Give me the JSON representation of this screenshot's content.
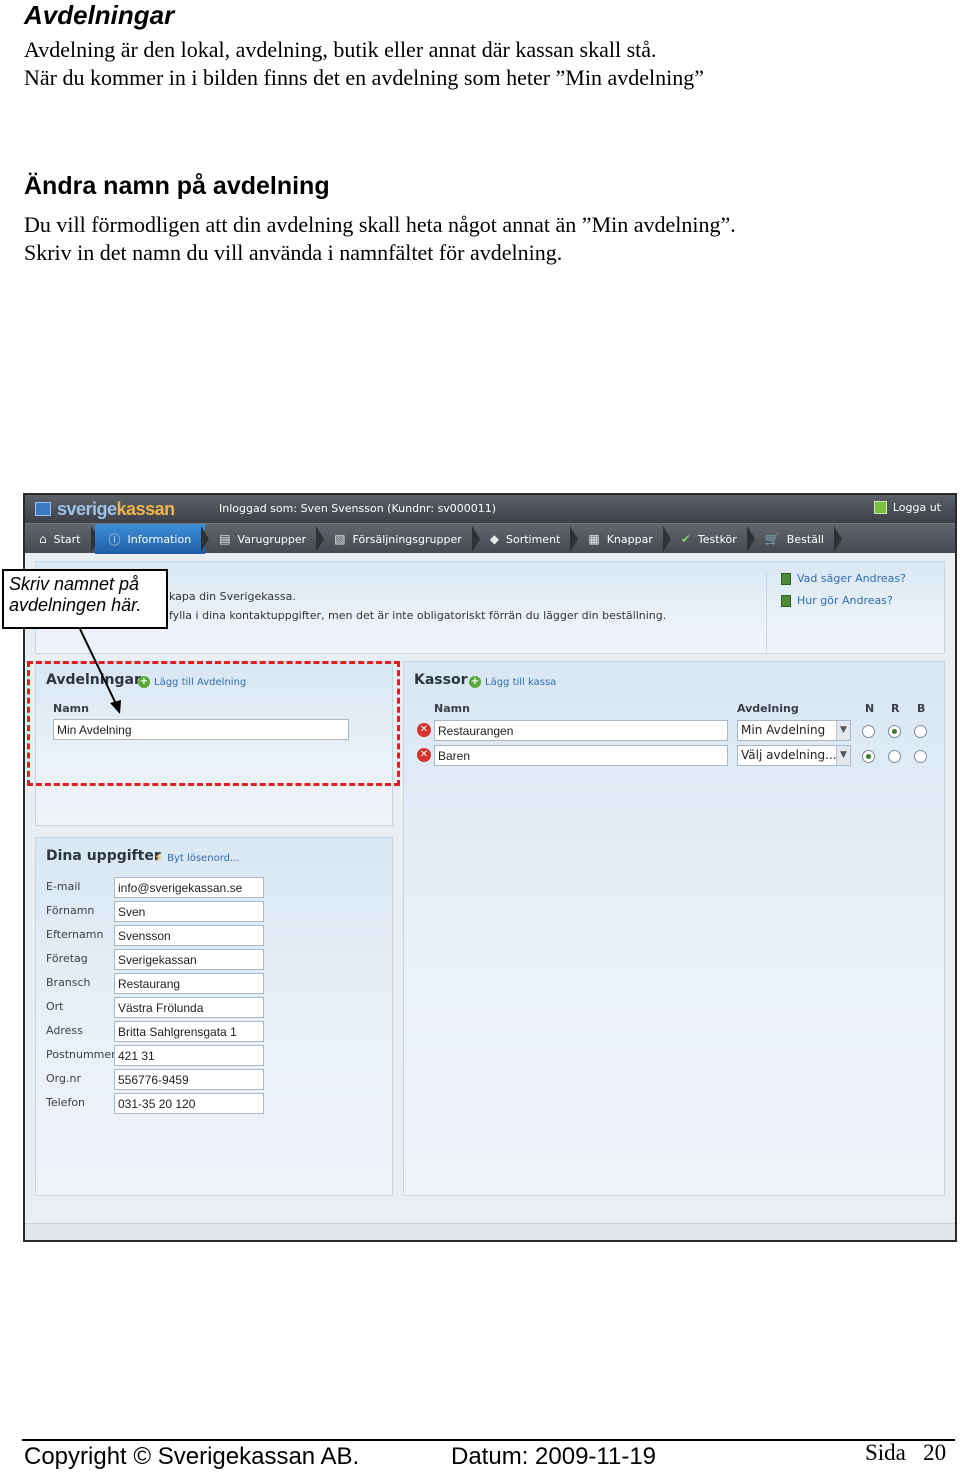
{
  "doc": {
    "title": "Avdelningar",
    "intro_line1": "Avdelning är den lokal, avdelning, butik eller annat där kassan skall stå.",
    "intro_line2": "När du kommer in i bilden finns det en avdelning som heter ”Min avdelning”",
    "section_title": "Ändra namn på avdelning",
    "section_line1": "Du vill förmodligen att din avdelning skall heta något annat än ”Min avdelning”.",
    "section_line2": "Skriv in det namn du vill använda i namnfältet för avdelning."
  },
  "callout": {
    "line1": "Skriv namnet på",
    "line2": "avdelningen här."
  },
  "app": {
    "logo_part1": "sverige",
    "logo_part2": "kassan",
    "login_info": "Inloggad som: Sven Svensson (Kundnr: sv000011)",
    "logout_label": "Logga ut",
    "nav": [
      {
        "label": "Start",
        "icon": "⌂"
      },
      {
        "label": "Information",
        "icon": "ⓘ"
      },
      {
        "label": "Varugrupper",
        "icon": "▤"
      },
      {
        "label": "Försäljningsgrupper",
        "icon": "▧"
      },
      {
        "label": "Sortiment",
        "icon": "◆"
      },
      {
        "label": "Knappar",
        "icon": "▦"
      },
      {
        "label": "Testkör",
        "icon": "✔"
      },
      {
        "label": "Beställ",
        "icon": "🛒"
      }
    ],
    "info": {
      "line1": "kapa din Sverigekassa.",
      "line2": "fylla i dina kontaktuppgifter, men det är inte obligatoriskt förrän du lägger din beställning.",
      "help1": "Vad säger Andreas?",
      "help2": "Hur gör Andreas?"
    },
    "avdelningar": {
      "title": "Avdelningar",
      "add_label": "Lägg till Avdelning",
      "name_header": "Namn",
      "name_value": "Min Avdelning"
    },
    "kassor": {
      "title": "Kassor",
      "add_label": "Lägg till kassa",
      "name_header": "Namn",
      "dept_header": "Avdelning",
      "n_header": "N",
      "r_header": "R",
      "b_header": "B",
      "rows": [
        {
          "name": "Restaurangen",
          "dept": "Min Avdelning",
          "selected": "R"
        },
        {
          "name": "Baren",
          "dept": "Välj avdelning...",
          "selected": "N"
        }
      ]
    },
    "user": {
      "title": "Dina uppgifter",
      "change_pw": "Byt lösenord...",
      "fields": [
        {
          "label": "E-mail",
          "value": "info@sverigekassan.se"
        },
        {
          "label": "Förnamn",
          "value": "Sven"
        },
        {
          "label": "Efternamn",
          "value": "Svensson"
        },
        {
          "label": "Företag",
          "value": "Sverigekassan"
        },
        {
          "label": "Bransch",
          "value": "Restaurang"
        },
        {
          "label": "Ort",
          "value": "Västra Frölunda"
        },
        {
          "label": "Adress",
          "value": "Britta Sahlgrensgata 1"
        },
        {
          "label": "Postnummer",
          "value": "421 31"
        },
        {
          "label": "Org.nr",
          "value": "556776-9459"
        },
        {
          "label": "Telefon",
          "value": "031-35 20 120"
        }
      ]
    }
  },
  "footer": {
    "copyright": "Copyright ©  Sverigekassan AB.",
    "date": "Datum:  2009-11-19",
    "page": "Sida   20"
  }
}
